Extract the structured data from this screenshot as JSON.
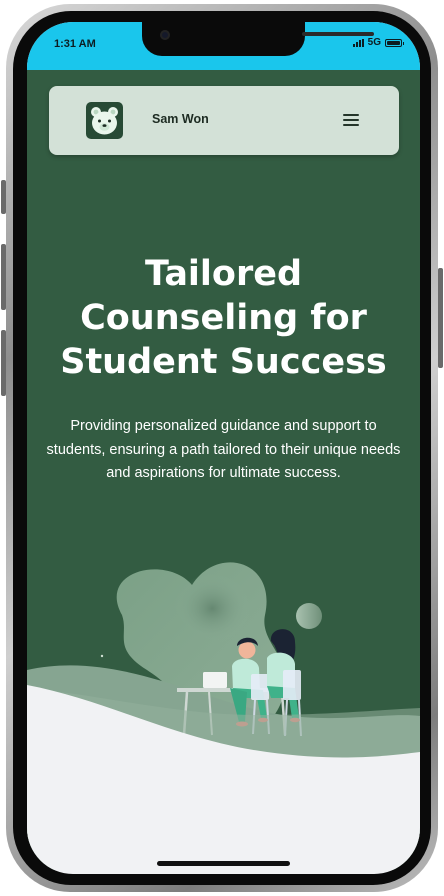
{
  "status_bar": {
    "time": "1:31 AM",
    "network": "5G"
  },
  "navbar": {
    "brand_name": "Sam Won",
    "logo_icon": "polar-bear-icon",
    "menu_icon": "hamburger-menu-icon"
  },
  "hero": {
    "title_lines": [
      "Tailored",
      "Counseling for",
      "Student Success"
    ],
    "subtitle": "Providing personalized guidance and support to students, ensuring a path tailored to their unique needs and aspirations for ultimate success."
  },
  "colors": {
    "status_bar": "#1ac6ec",
    "hero_background": "#335c42",
    "navbar_background": "#d3e1d7",
    "page_background": "#f1f2f4"
  }
}
